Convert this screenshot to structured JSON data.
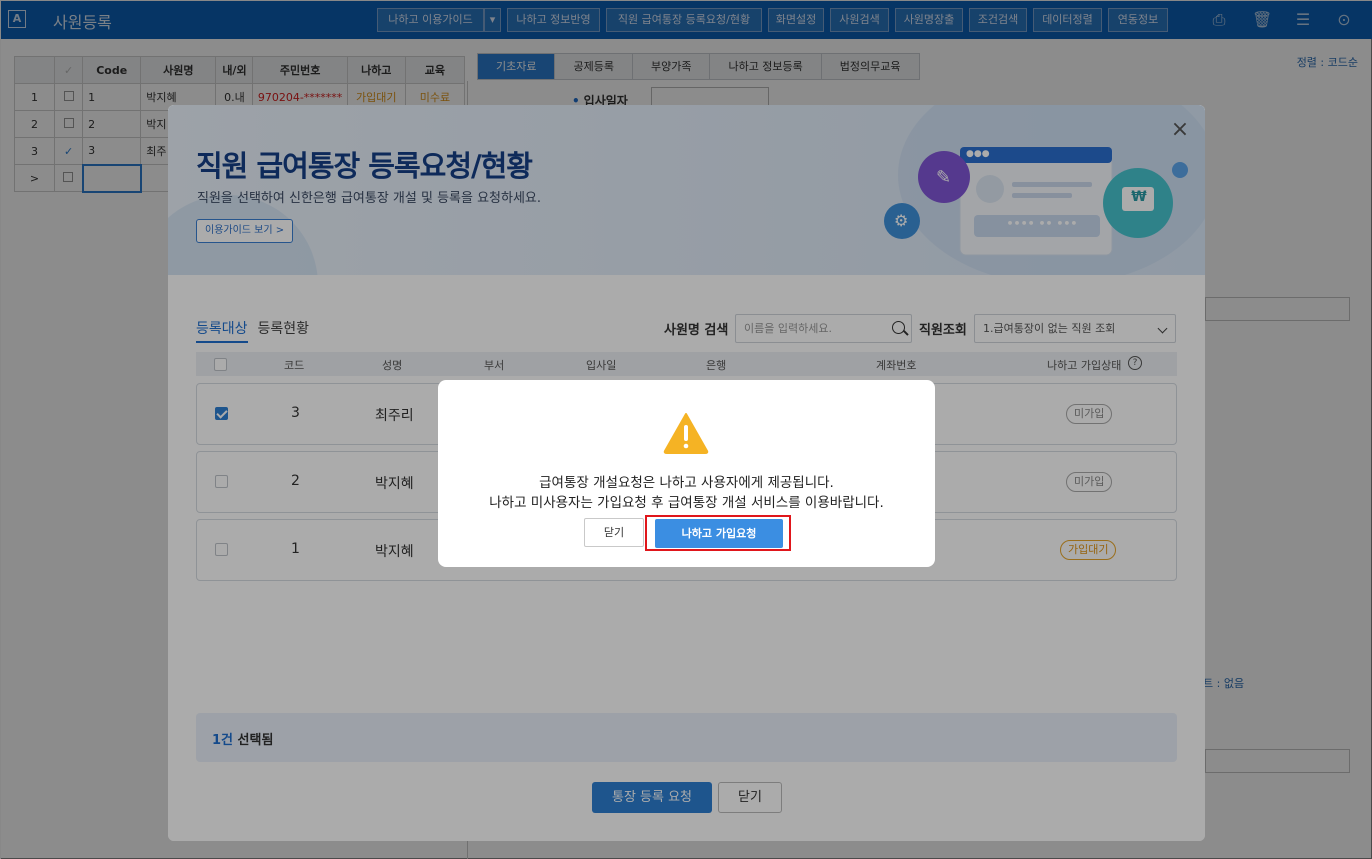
{
  "app": {
    "logo": "A",
    "title": "사원등록",
    "toolbar": {
      "guide": "나하고 이용가이드",
      "guide_arrow": "▾",
      "info_apply": "나하고 정보반영",
      "bankbook": "직원 급여통장 등록요청/현황",
      "screen_settings": "화면설정",
      "emp_search": "사원검색",
      "emp_card": "사원명장출",
      "cond_search": "조건검색",
      "data_sort": "데이터정렬",
      "link_info": "연동정보"
    }
  },
  "background": {
    "grid": {
      "headers": [
        "",
        "✓",
        "Code",
        "사원명",
        "내/외",
        "주민번호",
        "나하고",
        "교육"
      ],
      "rows": [
        {
          "num": "1",
          "code": "1",
          "name": "박지혜",
          "inout": "0.내",
          "rrn": "970204-*******",
          "nahago": "가입대기",
          "edu": "미수료"
        },
        {
          "num": "2",
          "code": "2",
          "name": "박지"
        },
        {
          "num": "3",
          "code": "3",
          "name": "최주"
        },
        {
          "num": ">"
        }
      ]
    },
    "tabs": [
      "기초자료",
      "공제등록",
      "부양가족",
      "나하고 정보등록",
      "법정의무교육"
    ],
    "sort_label": "정렬 : 코드순",
    "hire_date_label": "입사일자",
    "note": "트 : 없음"
  },
  "modal": {
    "title": "직원 급여통장 등록요청/현황",
    "subtitle": "직원을 선택하여 신한은행 급여통장 개설 및 등록을 요청하세요.",
    "guide_button": "이용가이드 보기 >",
    "close": "×",
    "tab_active": "등록대상",
    "tab_inactive": "등록현황",
    "search_label": "사원명 검색",
    "search_placeholder": "이름을 입력하세요.",
    "select_label": "직원조회",
    "select_value": "1.급여통장이 없는 직원 조회",
    "columns": {
      "code": "코드",
      "name": "성명",
      "dept": "부서",
      "hire": "입사일",
      "bank": "은행",
      "account": "계좌번호",
      "status": "나하고 가입상태",
      "help": "?"
    },
    "rows": [
      {
        "code": "3",
        "name": "최주리",
        "status": "미가입",
        "checked": true
      },
      {
        "code": "2",
        "name": "박지혜",
        "status": "미가입",
        "checked": false
      },
      {
        "code": "1",
        "name": "박지혜",
        "status": "가입대기",
        "checked": false
      }
    ],
    "selected_count": "1건",
    "selected_suffix": " 선택됨",
    "request_button": "통장 등록 요청",
    "close_button": "닫기",
    "banner_card": {
      "dots": "●●●",
      "pin": "•••• •• •••",
      "currency": "₩"
    }
  },
  "alert": {
    "line1": "급여통장 개설요청은 나하고 사용자에게 제공됩니다.",
    "line2": "나하고 미사용자는 가입요청 후 급여통장 개설 서비스를 이용바랍니다.",
    "close_button": "닫기",
    "join_button": "나하고 가입요청"
  },
  "colors": {
    "brand": "#0b62b8",
    "accent": "#2d7fd3",
    "highlight": "#e0161b",
    "warning": "#f5b324"
  }
}
